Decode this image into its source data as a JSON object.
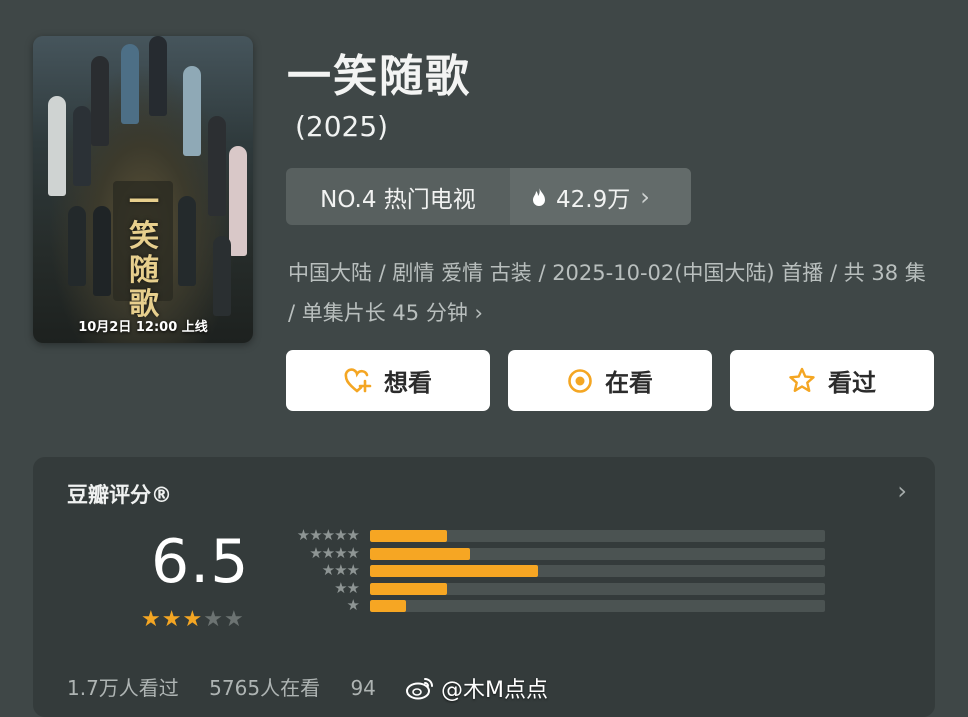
{
  "show": {
    "title": "一笑随歌",
    "year": "(2025)",
    "poster_calligraphy": "一笑随歌",
    "poster_badge": "10月2日 12:00 上线"
  },
  "rank": {
    "label": "NO.4 热门电视",
    "heat": "42.9万",
    "heat_icon": "flame-icon",
    "chevron": "›"
  },
  "meta": {
    "text": "中国大陆 / 剧情 爱情 古装 / 2025-10-02(中国大陆) 首播 / 共 38 集 / 单集片长 45 分钟",
    "chevron": "›"
  },
  "actions": [
    {
      "label": "想看",
      "icon": "heart-plus-icon"
    },
    {
      "label": "在看",
      "icon": "target-icon"
    },
    {
      "label": "看过",
      "icon": "star-outline-icon"
    }
  ],
  "rating": {
    "title": "豆瓣评分®",
    "chevron": "›",
    "score": "6.5",
    "stars_filled": 3,
    "stars_total": 5,
    "distribution": [
      {
        "stars": "★★★★★",
        "fraction": 0.17
      },
      {
        "stars": "★★★★",
        "fraction": 0.22
      },
      {
        "stars": "★★★",
        "fraction": 0.37
      },
      {
        "stars": "★★",
        "fraction": 0.17
      },
      {
        "stars": "★",
        "fraction": 0.08
      }
    ],
    "watched": "1.7万人看过",
    "watching": "5765人在看",
    "want_partial": "94"
  },
  "watermark": {
    "text": "@木M点点",
    "icon": "weibo-icon"
  },
  "colors": {
    "background": "#3f4747",
    "panel": "#343b3b",
    "accent": "#f6a623",
    "button_bg": "#ffffff"
  }
}
